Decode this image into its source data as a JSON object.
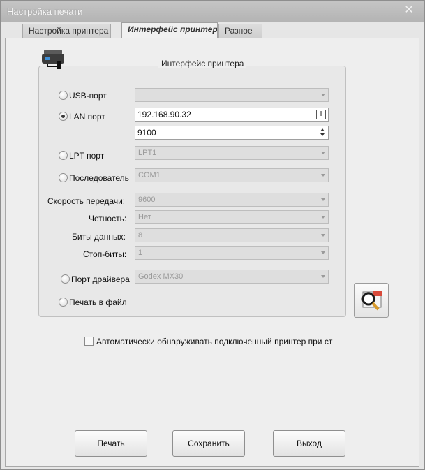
{
  "window": {
    "title": "Настройка печати",
    "close_icon": "close-icon"
  },
  "tabs": [
    {
      "label": "Настройка принтера"
    },
    {
      "label": "Интерфейс принтера",
      "active": true
    },
    {
      "label": "Разное"
    }
  ],
  "group": {
    "title": "Интерфейс принтера",
    "icon": "printer-icon"
  },
  "ports": {
    "usb": {
      "label": "USB-порт",
      "value": ""
    },
    "lan": {
      "label": "LAN порт",
      "ip": "192.168.90.32",
      "port": "9100",
      "checked": true
    },
    "lpt": {
      "label": "LPT порт",
      "value": "LPT1"
    },
    "serial": {
      "label": "Последователь",
      "value": "COM1"
    },
    "driver": {
      "label": "Порт драйвера",
      "value": "Godex MX30"
    },
    "file": {
      "label": "Печать в файл"
    }
  },
  "serial_settings": {
    "baud": {
      "label": "Скорость передачи:",
      "value": "9600"
    },
    "parity": {
      "label": "Четность:",
      "value": "Нет"
    },
    "databits": {
      "label": "Биты данных:",
      "value": "8"
    },
    "stopbits": {
      "label": "Стоп-биты:",
      "value": "1"
    }
  },
  "search_icon": "search-printer-icon",
  "auto_detect": {
    "label": "Автоматически обнаруживать подключенный принтер при ст",
    "checked": false
  },
  "buttons": {
    "print": "Печать",
    "save": "Сохранить",
    "exit": "Выход"
  }
}
